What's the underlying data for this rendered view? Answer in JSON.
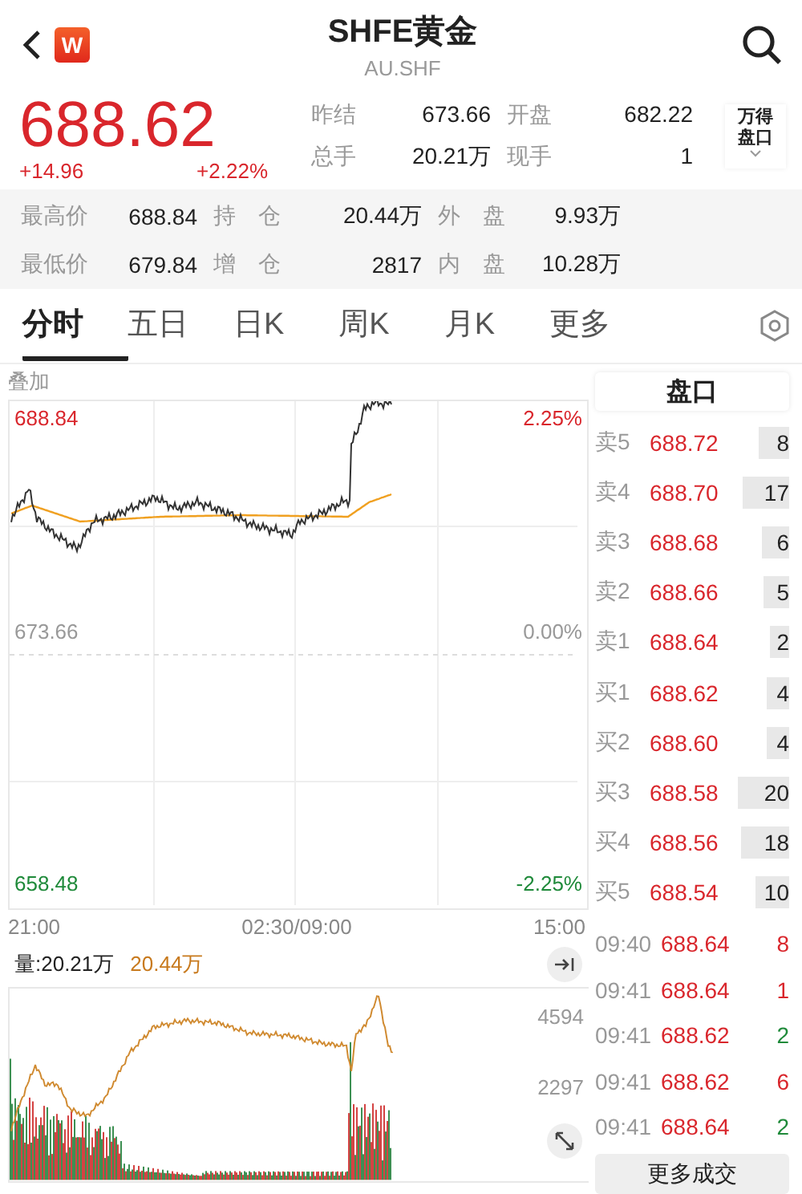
{
  "header": {
    "title": "SHFE黄金",
    "subtitle": "AU.SHF",
    "logo": "W"
  },
  "quote": {
    "price": "688.62",
    "change": "+14.96",
    "change_pct": "+2.22%",
    "fields": [
      {
        "label": "昨结",
        "value": "673.66"
      },
      {
        "label": "开盘",
        "value": "682.22"
      },
      {
        "label": "总手",
        "value": "20.21万"
      },
      {
        "label": "现手",
        "value": "1"
      }
    ],
    "side_button": {
      "line1": "万得",
      "line2": "盘口"
    }
  },
  "stats": [
    {
      "label": "最高价",
      "value": "688.84"
    },
    {
      "label": "持　仓",
      "value": "20.44万"
    },
    {
      "label": "外　盘",
      "value": "9.93万"
    },
    {
      "label": "最低价",
      "value": "679.84"
    },
    {
      "label": "增　仓",
      "value": "2817"
    },
    {
      "label": "内　盘",
      "value": "10.28万"
    }
  ],
  "tabs": [
    {
      "label": "分时",
      "selected": true
    },
    {
      "label": "五日",
      "selected": false
    },
    {
      "label": "日K",
      "selected": false
    },
    {
      "label": "周K",
      "selected": false
    },
    {
      "label": "月K",
      "selected": false
    },
    {
      "label": "更多",
      "selected": false
    }
  ],
  "chart": {
    "overlay_label": "叠加",
    "price_high": "688.84",
    "price_mid": "673.66",
    "price_low": "658.48",
    "pct_high": "2.25%",
    "pct_mid": "0.00%",
    "pct_low": "-2.25%",
    "times": [
      "21:00",
      "02:30/09:00",
      "15:00"
    ],
    "volume_label": "量:20.21万",
    "open_interest_label": "20.44万",
    "volume_max": "4594",
    "volume_mid": "2297"
  },
  "order_book": {
    "title": "盘口",
    "rows": [
      {
        "label": "卖5",
        "price": "688.72",
        "volume": "8"
      },
      {
        "label": "卖4",
        "price": "688.70",
        "volume": "17"
      },
      {
        "label": "卖3",
        "price": "688.68",
        "volume": "6"
      },
      {
        "label": "卖2",
        "price": "688.66",
        "volume": "5"
      },
      {
        "label": "卖1",
        "price": "688.64",
        "volume": "2"
      },
      {
        "label": "买1",
        "price": "688.62",
        "volume": "4"
      },
      {
        "label": "买2",
        "price": "688.60",
        "volume": "4"
      },
      {
        "label": "买3",
        "price": "688.58",
        "volume": "20"
      },
      {
        "label": "买4",
        "price": "688.56",
        "volume": "18"
      },
      {
        "label": "买5",
        "price": "688.54",
        "volume": "10"
      }
    ]
  },
  "trades": {
    "rows": [
      {
        "time": "09:40",
        "price": "688.64",
        "volume": "8",
        "color": "#d9262c"
      },
      {
        "time": "09:41",
        "price": "688.64",
        "volume": "1",
        "color": "#d9262c"
      },
      {
        "time": "09:41",
        "price": "688.62",
        "volume": "2",
        "color": "#1f8a3a"
      },
      {
        "time": "09:41",
        "price": "688.62",
        "volume": "6",
        "color": "#d9262c"
      },
      {
        "time": "09:41",
        "price": "688.64",
        "volume": "2",
        "color": "#1f8a3a"
      }
    ],
    "more_button": "更多成交"
  }
}
